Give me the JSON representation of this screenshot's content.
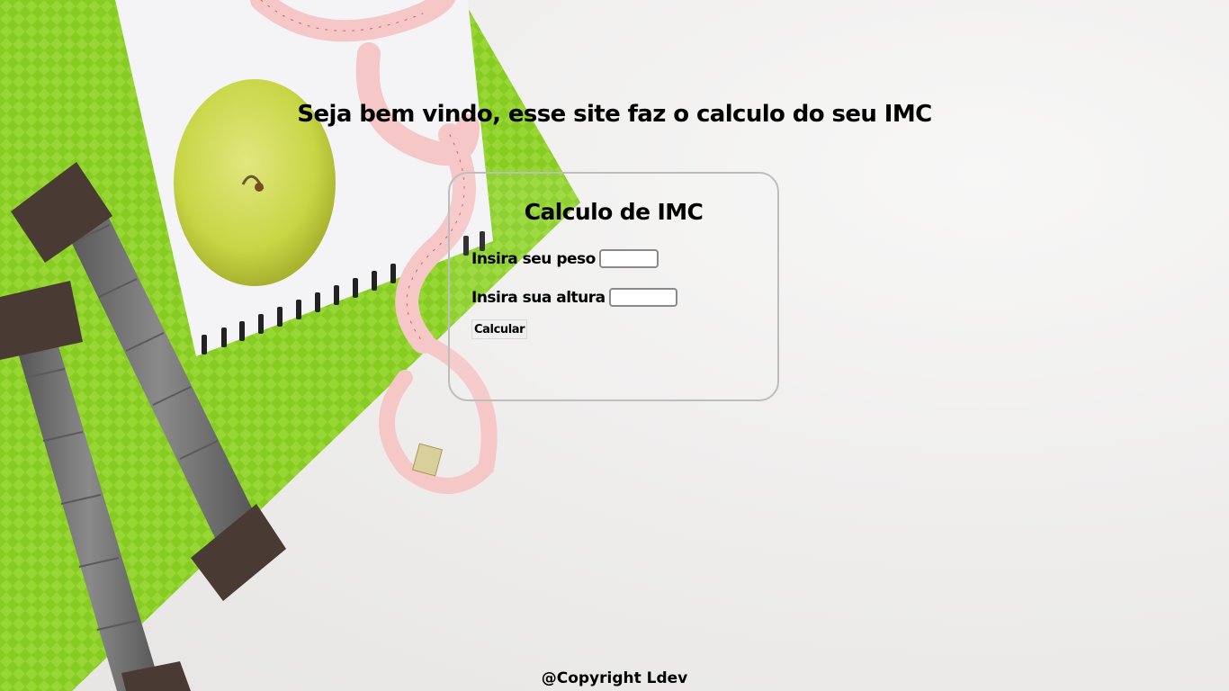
{
  "header": {
    "title": "Seja bem vindo, esse site faz o calculo do seu IMC"
  },
  "form": {
    "title": "Calculo de IMC",
    "weight_label": "Insira seu peso",
    "weight_value": "",
    "height_label": "Insira sua altura",
    "height_value": "",
    "button_label": "Calcular"
  },
  "footer": {
    "text": "@Copyright Ldev"
  },
  "background": {
    "icons": [
      "apple-icon",
      "dumbbell-icon",
      "measuring-tape-icon",
      "notebook-icon",
      "exercise-mat-icon"
    ],
    "colors": {
      "mat": "#8ccf2a",
      "notebook": "#f4f4f6",
      "apple": "#cddb52",
      "dumbbell_handle": "#6e6e6e",
      "dumbbell_end": "#4a3a34",
      "tape": "#f3b9b9"
    }
  }
}
